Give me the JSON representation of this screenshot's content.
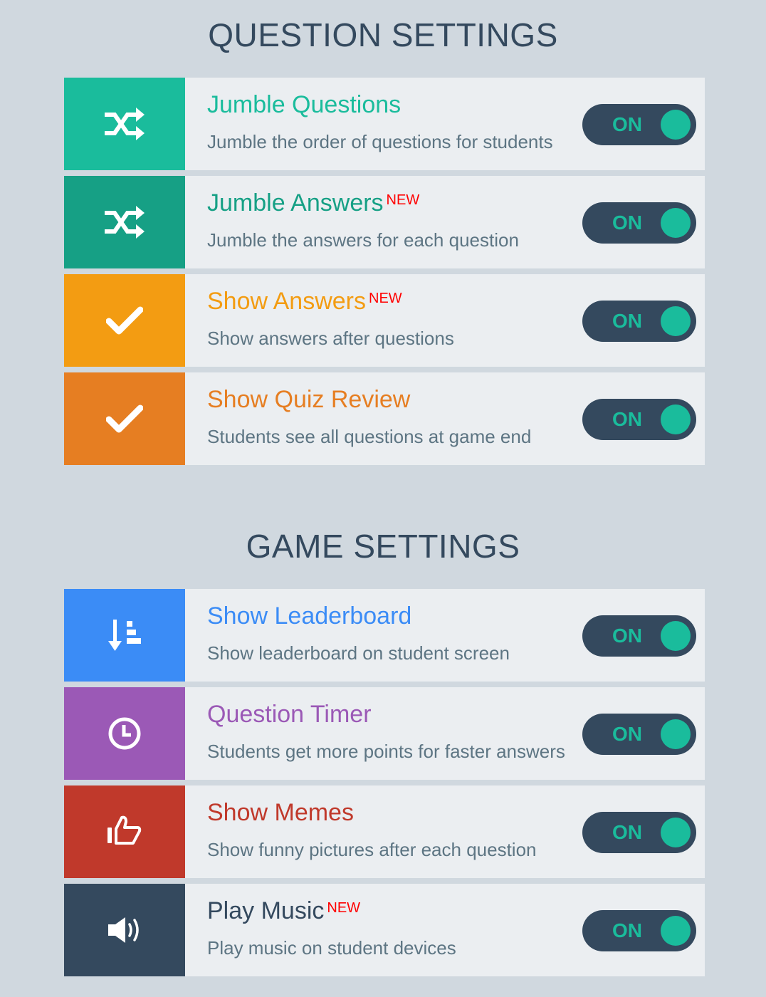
{
  "sections": [
    {
      "title": "QUESTION SETTINGS",
      "rows": [
        {
          "title": "Jumble Questions",
          "new": "",
          "desc": "Jumble the order of questions for students",
          "toggle": "ON",
          "icon": "shuffle-icon",
          "color": "#1abc9c"
        },
        {
          "title": "Jumble Answers",
          "new": "NEW",
          "desc": "Jumble the answers for each question",
          "toggle": "ON",
          "icon": "shuffle-icon",
          "color": "#16a085"
        },
        {
          "title": "Show Answers",
          "new": "NEW",
          "desc": "Show answers after questions",
          "toggle": "ON",
          "icon": "check-icon",
          "color": "#f39c12"
        },
        {
          "title": "Show Quiz Review",
          "new": "",
          "desc": "Students see all questions at game end",
          "toggle": "ON",
          "icon": "check-icon",
          "color": "#e67e22"
        }
      ]
    },
    {
      "title": "GAME SETTINGS",
      "rows": [
        {
          "title": "Show Leaderboard",
          "new": "",
          "desc": "Show leaderboard on student screen",
          "toggle": "ON",
          "icon": "sort-descending-icon",
          "color": "#3b8cf6"
        },
        {
          "title": "Question Timer",
          "new": "",
          "desc": "Students get more points for faster answers",
          "toggle": "ON",
          "icon": "clock-icon",
          "color": "#9b59b6"
        },
        {
          "title": "Show Memes",
          "new": "",
          "desc": "Show funny pictures after each question",
          "toggle": "ON",
          "icon": "thumbs-up-icon",
          "color": "#c0392b"
        },
        {
          "title": "Play Music",
          "new": "NEW",
          "desc": "Play music on student devices",
          "toggle": "ON",
          "icon": "volume-icon",
          "color": "#34495e"
        }
      ]
    }
  ],
  "colors": {
    "toggle_bg": "#34495e",
    "toggle_on": "#1abc9c",
    "new_badge": "#ff0000",
    "desc_text": "#5d7583",
    "play_music_title": "#34495e"
  }
}
